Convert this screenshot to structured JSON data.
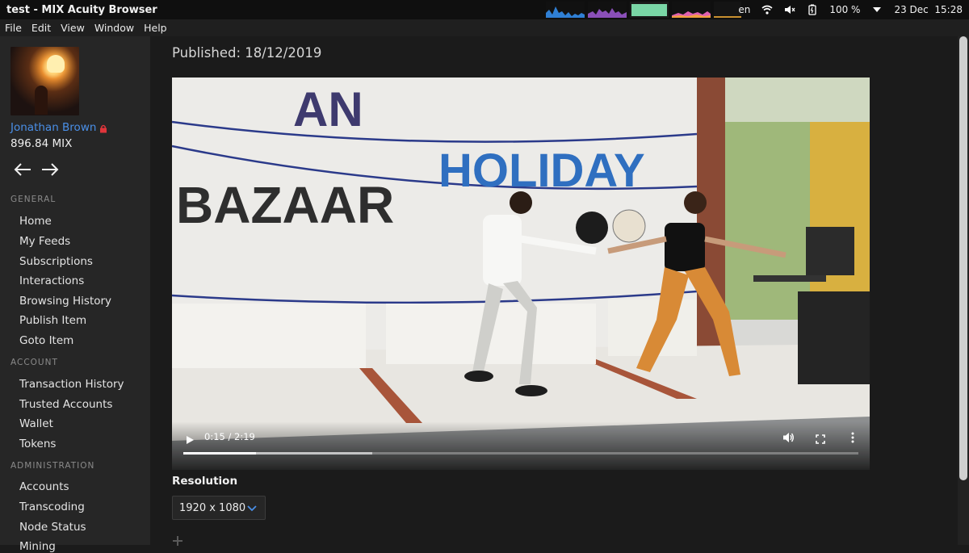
{
  "window": {
    "title": "test - MIX Acuity Browser"
  },
  "tray": {
    "lang": "en",
    "battery": "100 %",
    "date": "23 Dec",
    "time": "15:28"
  },
  "menu": [
    "File",
    "Edit",
    "View",
    "Window",
    "Help"
  ],
  "user": {
    "name": "Jonathan Brown",
    "balance": "896.84 MIX"
  },
  "sidebar": {
    "general_title": "GENERAL",
    "general": [
      "Home",
      "My Feeds",
      "Subscriptions",
      "Interactions",
      "Browsing History",
      "Publish Item",
      "Goto Item"
    ],
    "account_title": "ACCOUNT",
    "account": [
      "Transaction History",
      "Trusted Accounts",
      "Wallet",
      "Tokens"
    ],
    "admin_title": "ADMINISTRATION",
    "admin": [
      "Accounts",
      "Transcoding",
      "Node Status",
      "Mining"
    ]
  },
  "content": {
    "published": "Published: 18/12/2019",
    "video": {
      "time": "0:15 / 2:19",
      "progress": 0.108,
      "buffered": 0.28,
      "banner_line1": "HOLIDAY",
      "banner_line2": "BAZAAR",
      "banner_top": "AN"
    },
    "resolution_label": "Resolution",
    "resolution_value": "1920 x 1080"
  },
  "colors": {
    "accent": "#4a8fe7",
    "sidebar_bg": "#262626",
    "main_bg": "#1b1b1b"
  }
}
